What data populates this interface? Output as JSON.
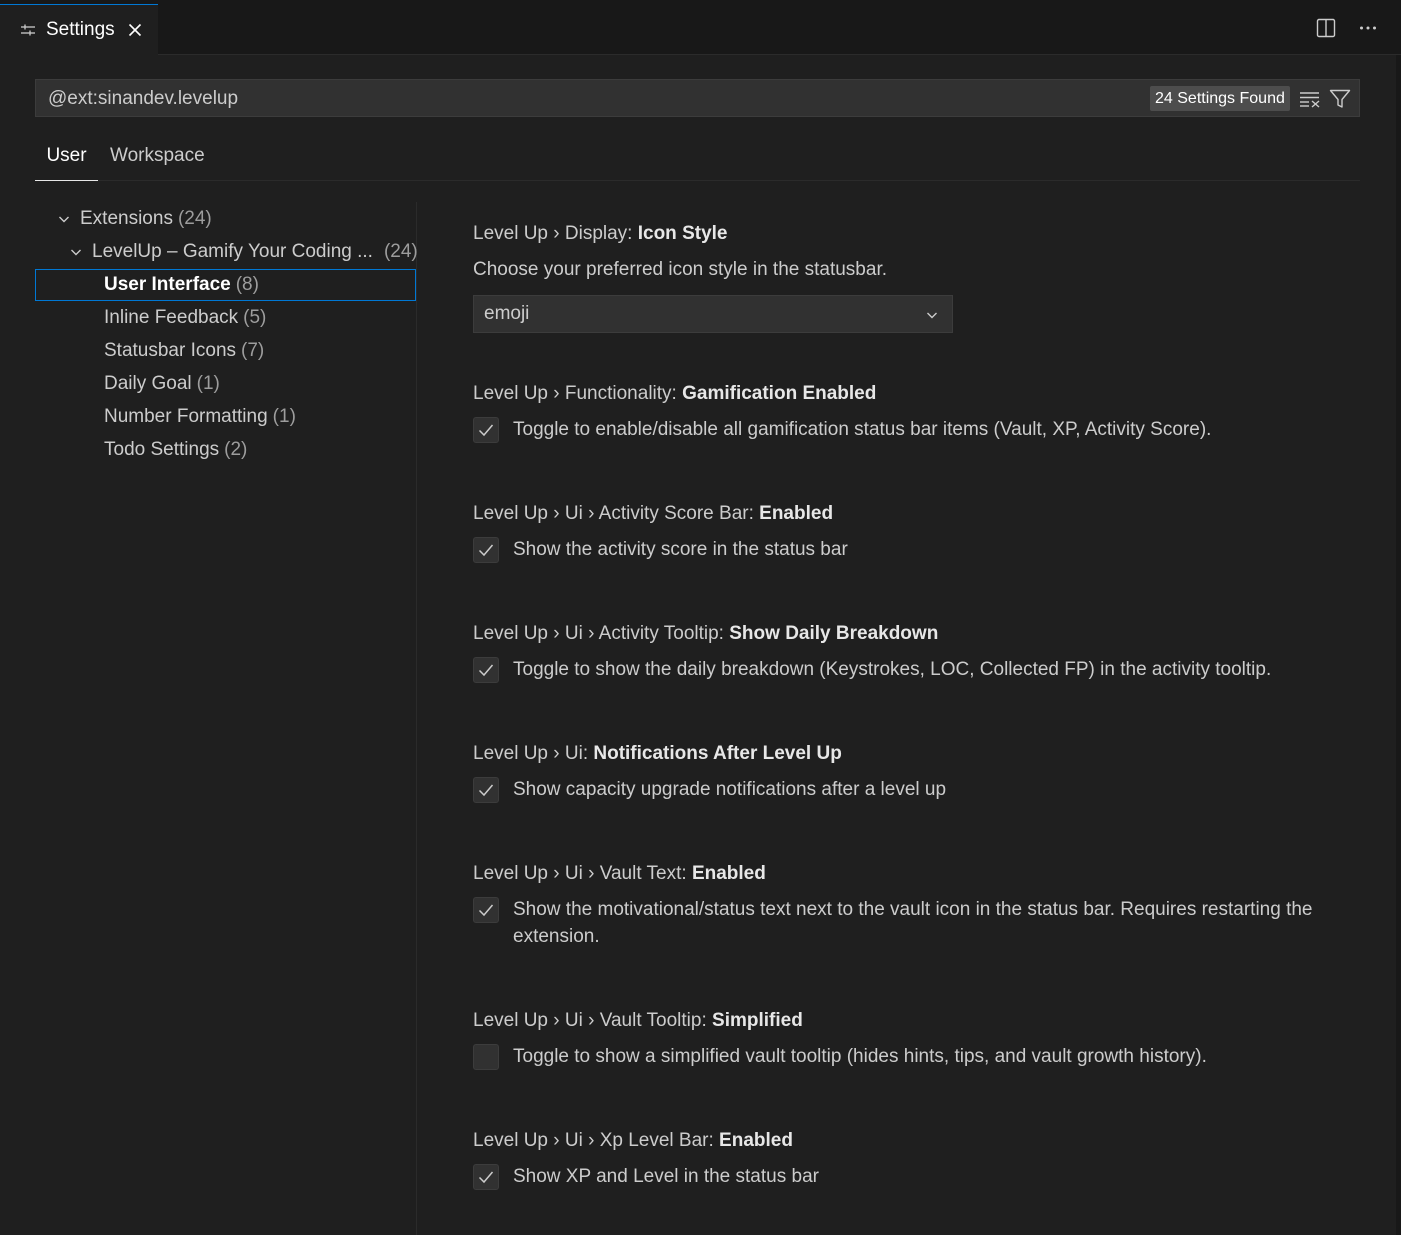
{
  "tab": {
    "title": "Settings"
  },
  "search": {
    "value": "@ext:sinandev.levelup",
    "count": "24 Settings Found"
  },
  "scope_tabs": [
    {
      "label": "User"
    },
    {
      "label": "Workspace"
    }
  ],
  "toc": [
    {
      "label": "Extensions",
      "count": "(24)"
    },
    {
      "label": "LevelUp – Gamify Your Coding ...",
      "count": "(24)"
    },
    {
      "label": "User Interface",
      "count": "(8)"
    },
    {
      "label": "Inline Feedback",
      "count": "(5)"
    },
    {
      "label": "Statusbar Icons",
      "count": "(7)"
    },
    {
      "label": "Daily Goal",
      "count": "(1)"
    },
    {
      "label": "Number Formatting",
      "count": "(1)"
    },
    {
      "label": "Todo Settings",
      "count": "(2)"
    }
  ],
  "settings": [
    {
      "category": "Level Up › Display: ",
      "name": "Icon Style",
      "description": "Choose your preferred icon style in the statusbar.",
      "value": "emoji"
    },
    {
      "category": "Level Up › Functionality: ",
      "name": "Gamification Enabled",
      "description": "Toggle to enable/disable all gamification status bar items (Vault, XP, Activity Score).",
      "checked": true
    },
    {
      "category": "Level Up › Ui › Activity Score Bar: ",
      "name": "Enabled",
      "description": "Show the activity score in the status bar",
      "checked": true
    },
    {
      "category": "Level Up › Ui › Activity Tooltip: ",
      "name": "Show Daily Breakdown",
      "description": "Toggle to show the daily breakdown (Keystrokes, LOC, Collected FP) in the activity tooltip.",
      "checked": true
    },
    {
      "category": "Level Up › Ui: ",
      "name": "Notifications After Level Up",
      "description": "Show capacity upgrade notifications after a level up",
      "checked": true
    },
    {
      "category": "Level Up › Ui › Vault Text: ",
      "name": "Enabled",
      "description": "Show the motivational/status text next to the vault icon in the status bar. Requires restarting the extension.",
      "checked": true
    },
    {
      "category": "Level Up › Ui › Vault Tooltip: ",
      "name": "Simplified",
      "description": "Toggle to show a simplified vault tooltip (hides hints, tips, and vault growth history).",
      "checked": false
    },
    {
      "category": "Level Up › Ui › Xp Level Bar: ",
      "name": "Enabled",
      "description": "Show XP and Level in the status bar",
      "checked": true
    }
  ]
}
